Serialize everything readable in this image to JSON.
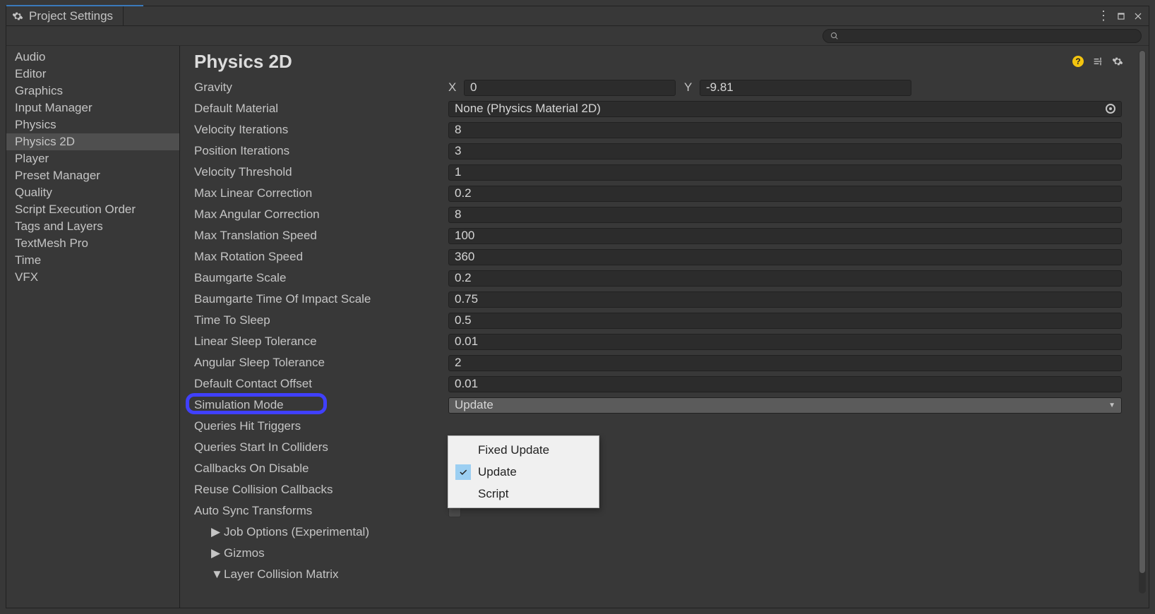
{
  "window": {
    "title": "Project Settings"
  },
  "search": {
    "placeholder": ""
  },
  "sidebar": {
    "items": [
      {
        "label": "Audio"
      },
      {
        "label": "Editor"
      },
      {
        "label": "Graphics"
      },
      {
        "label": "Input Manager"
      },
      {
        "label": "Physics"
      },
      {
        "label": "Physics 2D"
      },
      {
        "label": "Player"
      },
      {
        "label": "Preset Manager"
      },
      {
        "label": "Quality"
      },
      {
        "label": "Script Execution Order"
      },
      {
        "label": "Tags and Layers"
      },
      {
        "label": "TextMesh Pro"
      },
      {
        "label": "Time"
      },
      {
        "label": "VFX"
      }
    ],
    "selected_index": 5
  },
  "page": {
    "title": "Physics 2D",
    "gravity": {
      "label": "Gravity",
      "x_label": "X",
      "x": "0",
      "y_label": "Y",
      "y": "-9.81"
    },
    "default_material": {
      "label": "Default Material",
      "value": "None (Physics Material 2D)"
    },
    "velocity_iterations": {
      "label": "Velocity Iterations",
      "value": "8"
    },
    "position_iterations": {
      "label": "Position Iterations",
      "value": "3"
    },
    "velocity_threshold": {
      "label": "Velocity Threshold",
      "value": "1"
    },
    "max_linear_correction": {
      "label": "Max Linear Correction",
      "value": "0.2"
    },
    "max_angular_correction": {
      "label": "Max Angular Correction",
      "value": "8"
    },
    "max_translation_speed": {
      "label": "Max Translation Speed",
      "value": "100"
    },
    "max_rotation_speed": {
      "label": "Max Rotation Speed",
      "value": "360"
    },
    "baumgarte_scale": {
      "label": "Baumgarte Scale",
      "value": "0.2"
    },
    "baumgarte_toi_scale": {
      "label": "Baumgarte Time Of Impact Scale",
      "value": "0.75"
    },
    "time_to_sleep": {
      "label": "Time To Sleep",
      "value": "0.5"
    },
    "linear_sleep_tolerance": {
      "label": "Linear Sleep Tolerance",
      "value": "0.01"
    },
    "angular_sleep_tolerance": {
      "label": "Angular Sleep Tolerance",
      "value": "2"
    },
    "default_contact_offset": {
      "label": "Default Contact Offset",
      "value": "0.01"
    },
    "simulation_mode": {
      "label": "Simulation Mode",
      "value": "Update",
      "options": [
        "Fixed Update",
        "Update",
        "Script"
      ],
      "selected_index": 1
    },
    "queries_hit_triggers": {
      "label": "Queries Hit Triggers"
    },
    "queries_start_in_colliders": {
      "label": "Queries Start In Colliders"
    },
    "callbacks_on_disable": {
      "label": "Callbacks On Disable"
    },
    "reuse_collision_callbacks": {
      "label": "Reuse Collision Callbacks"
    },
    "auto_sync_transforms": {
      "label": "Auto Sync Transforms"
    },
    "job_options": {
      "label": "Job Options (Experimental)"
    },
    "gizmos": {
      "label": "Gizmos"
    },
    "layer_collision_matrix": {
      "label": "Layer Collision Matrix"
    }
  }
}
